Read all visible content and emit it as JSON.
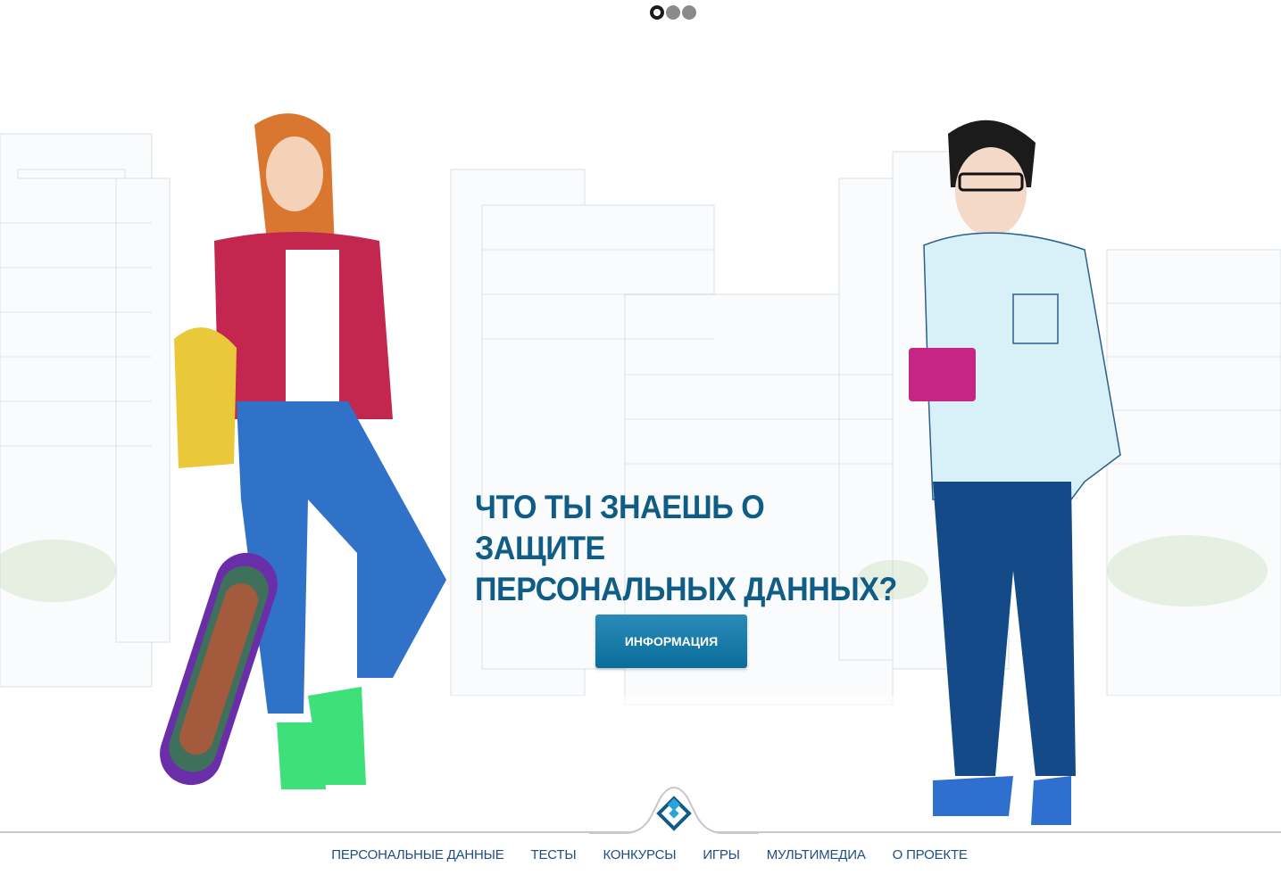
{
  "slider": {
    "dots": [
      {
        "active": true
      },
      {
        "active": false
      },
      {
        "active": false
      }
    ]
  },
  "hero": {
    "title_line1": "ЧТО ТЫ ЗНАЕШЬ О ЗАЩИТЕ",
    "title_line2": "ПЕРСОНАЛЬНЫХ ДАННЫХ?",
    "button_label": "ИНФОРМАЦИЯ"
  },
  "logo": {
    "icon": "roskomnadzor-logo-icon"
  },
  "nav": {
    "items": [
      {
        "label": "ПЕРСОНАЛЬНЫЕ ДАННЫЕ"
      },
      {
        "label": "ТЕСТЫ"
      },
      {
        "label": "КОНКУРСЫ"
      },
      {
        "label": "ИГРЫ"
      },
      {
        "label": "МУЛЬТИМЕДИА"
      },
      {
        "label": "О ПРОЕКТЕ"
      }
    ]
  },
  "colors": {
    "title": "#0f5c86",
    "button": "#1279a8",
    "nav_link": "#1e4e82"
  }
}
